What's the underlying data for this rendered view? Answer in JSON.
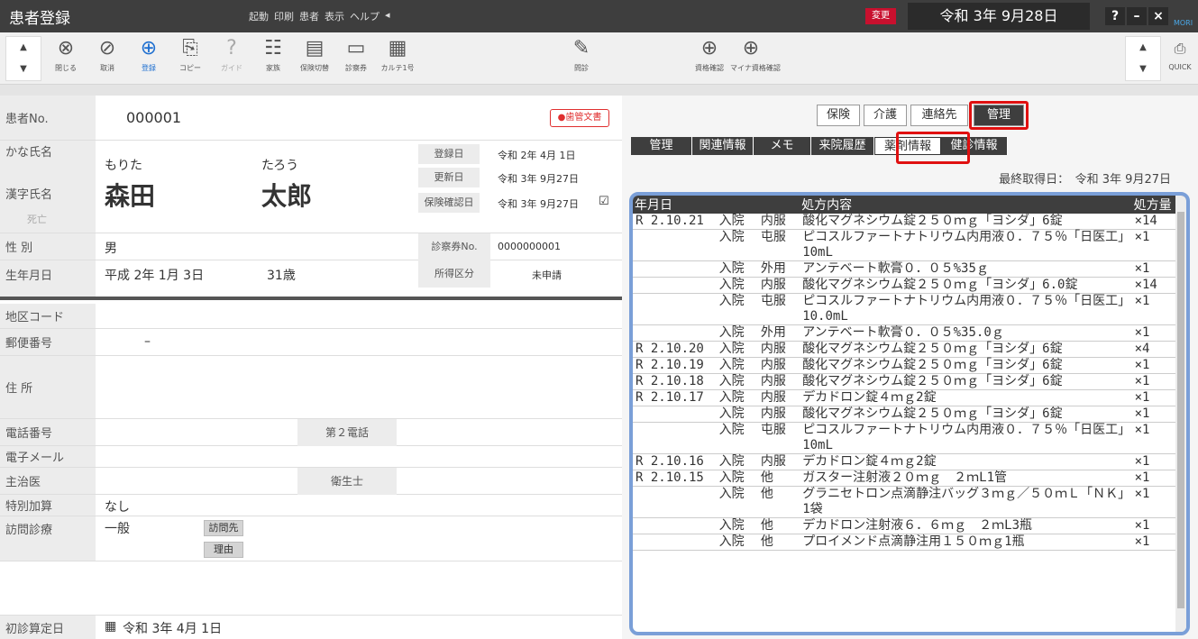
{
  "window": {
    "title": "患者登録",
    "menu": [
      "起動",
      "印刷",
      "患者",
      "表示",
      "ヘルプ",
      "◂"
    ],
    "change_badge": "変更",
    "date": "令和 3年 9月28日",
    "help": "?",
    "minimize": "–",
    "close": "×",
    "logo": "MORI"
  },
  "toolbar": {
    "buttons": [
      {
        "label": "閉じる",
        "icon": "close-circle-icon",
        "glyph": "⊗"
      },
      {
        "label": "取消",
        "icon": "cancel-icon",
        "glyph": "⊘"
      },
      {
        "label": "登録",
        "icon": "register-icon",
        "glyph": "⊕"
      },
      {
        "label": "コピー",
        "icon": "copy-icon",
        "glyph": "⎘"
      },
      {
        "label": "ガイド",
        "icon": "guide-icon",
        "glyph": "?"
      },
      {
        "label": "家族",
        "icon": "family-icon",
        "glyph": "☷"
      },
      {
        "label": "保険切替",
        "icon": "insurance-switch-icon",
        "glyph": "▤"
      },
      {
        "label": "診察券",
        "icon": "card-icon",
        "glyph": "▭"
      },
      {
        "label": "カルテ1号",
        "icon": "chart-icon",
        "glyph": "▦"
      },
      {
        "label": "問診",
        "icon": "interview-icon",
        "glyph": "✎"
      },
      {
        "label": "資格確認",
        "icon": "qualify-icon",
        "glyph": "⊕"
      },
      {
        "label": "マイナ資格確認",
        "icon": "myna-icon",
        "glyph": "⊕"
      }
    ],
    "quick": "QUICK"
  },
  "patient": {
    "no_label": "患者No.",
    "no": "000001",
    "dental_doc": "歯管文書",
    "kana_label": "かな氏名",
    "kana_last": "もりた",
    "kana_first": "たろう",
    "kanji_label": "漢字氏名",
    "kanji_last": "森田",
    "kanji_first": "太郎",
    "deceased": "死亡",
    "reg_label": "登録日",
    "reg_date": "令和 2年 4月 1日",
    "upd_label": "更新日",
    "upd_date": "令和 3年 9月27日",
    "ins_label": "保険確認日",
    "ins_date": "令和 3年 9月27日",
    "ins_check": "☑",
    "sex_label": "性 別",
    "sex": "男",
    "card_label": "診察券No.",
    "card_no": "0000000001",
    "birth_label": "生年月日",
    "birth": "平成 2年 1月 3日",
    "age": "31歳",
    "income_label": "所得区分",
    "income": "未申請",
    "area_label": "地区コード",
    "zip_label": "郵便番号",
    "zip": "–",
    "addr_label": "住 所",
    "tel_label": "電話番号",
    "tel2_label": "第２電話",
    "mail_label": "電子メール",
    "doctor_label": "主治医",
    "hygienist_label": "衛生士",
    "special_label": "特別加算",
    "special": "なし",
    "visit_label": "訪問診療",
    "visit": "一般",
    "visit_dest": "訪問先",
    "reason": "理由",
    "first_label": "初診算定日",
    "first_date": "令和 3年 4月 1日"
  },
  "right": {
    "tabs": [
      "保険",
      "介護",
      "連絡先",
      "管理"
    ],
    "subtabs": [
      "管理",
      "関連情報",
      "メモ",
      "来院履歴",
      "薬剤情報",
      "健診情報"
    ],
    "last_get": "最終取得日：　令和 3年 9月27日",
    "headers": [
      "年月日",
      "",
      "",
      "処方内容",
      "処方量"
    ],
    "rows": [
      [
        "R 2.10.21",
        "入院",
        "内服",
        "酸化マグネシウム錠２５０ｍｇ「ヨシダ」6錠",
        "×14"
      ],
      [
        "",
        "入院",
        "屯服",
        "ピコスルファートナトリウム内用液０．７５％「日医工」10mL",
        "×1"
      ],
      [
        "",
        "入院",
        "外用",
        "アンテベート軟膏０．０５%35ｇ",
        "×1"
      ],
      [
        "",
        "入院",
        "内服",
        "酸化マグネシウム錠２５０ｍｇ「ヨシダ」6.0錠",
        "×14"
      ],
      [
        "",
        "入院",
        "屯服",
        "ピコスルファートナトリウム内用液０．７５％「日医工」10.0mL",
        "×1"
      ],
      [
        "",
        "入院",
        "外用",
        "アンテベート軟膏０．０５%35.0ｇ",
        "×1"
      ],
      [
        "R 2.10.20",
        "入院",
        "内服",
        "酸化マグネシウム錠２５０ｍｇ「ヨシダ」6錠",
        "×4"
      ],
      [
        "R 2.10.19",
        "入院",
        "内服",
        "酸化マグネシウム錠２５０ｍｇ「ヨシダ」6錠",
        "×1"
      ],
      [
        "R 2.10.18",
        "入院",
        "内服",
        "酸化マグネシウム錠２５０ｍｇ「ヨシダ」6錠",
        "×1"
      ],
      [
        "R 2.10.17",
        "入院",
        "内服",
        "デカドロン錠４ｍｇ2錠",
        "×1"
      ],
      [
        "",
        "入院",
        "内服",
        "酸化マグネシウム錠２５０ｍｇ「ヨシダ」6錠",
        "×1"
      ],
      [
        "",
        "入院",
        "屯服",
        "ピコスルファートナトリウム内用液０．７５％「日医工」10mL",
        "×1"
      ],
      [
        "R 2.10.16",
        "入院",
        "内服",
        "デカドロン錠４ｍｇ2錠",
        "×1"
      ],
      [
        "R 2.10.15",
        "入院",
        "他",
        "ガスター注射液２０ｍｇ　２ｍL1管",
        "×1"
      ],
      [
        "",
        "入院",
        "他",
        "グラニセトロン点滴静注バッグ３ｍｇ／５０ｍＬ「ＮＫ」1袋",
        "×1"
      ],
      [
        "",
        "入院",
        "他",
        "デカドロン注射液６．６ｍｇ　２ｍL3瓶",
        "×1"
      ],
      [
        "",
        "入院",
        "他",
        "プロイメンド点滴静注用１５０ｍｇ1瓶",
        "×1"
      ]
    ]
  }
}
